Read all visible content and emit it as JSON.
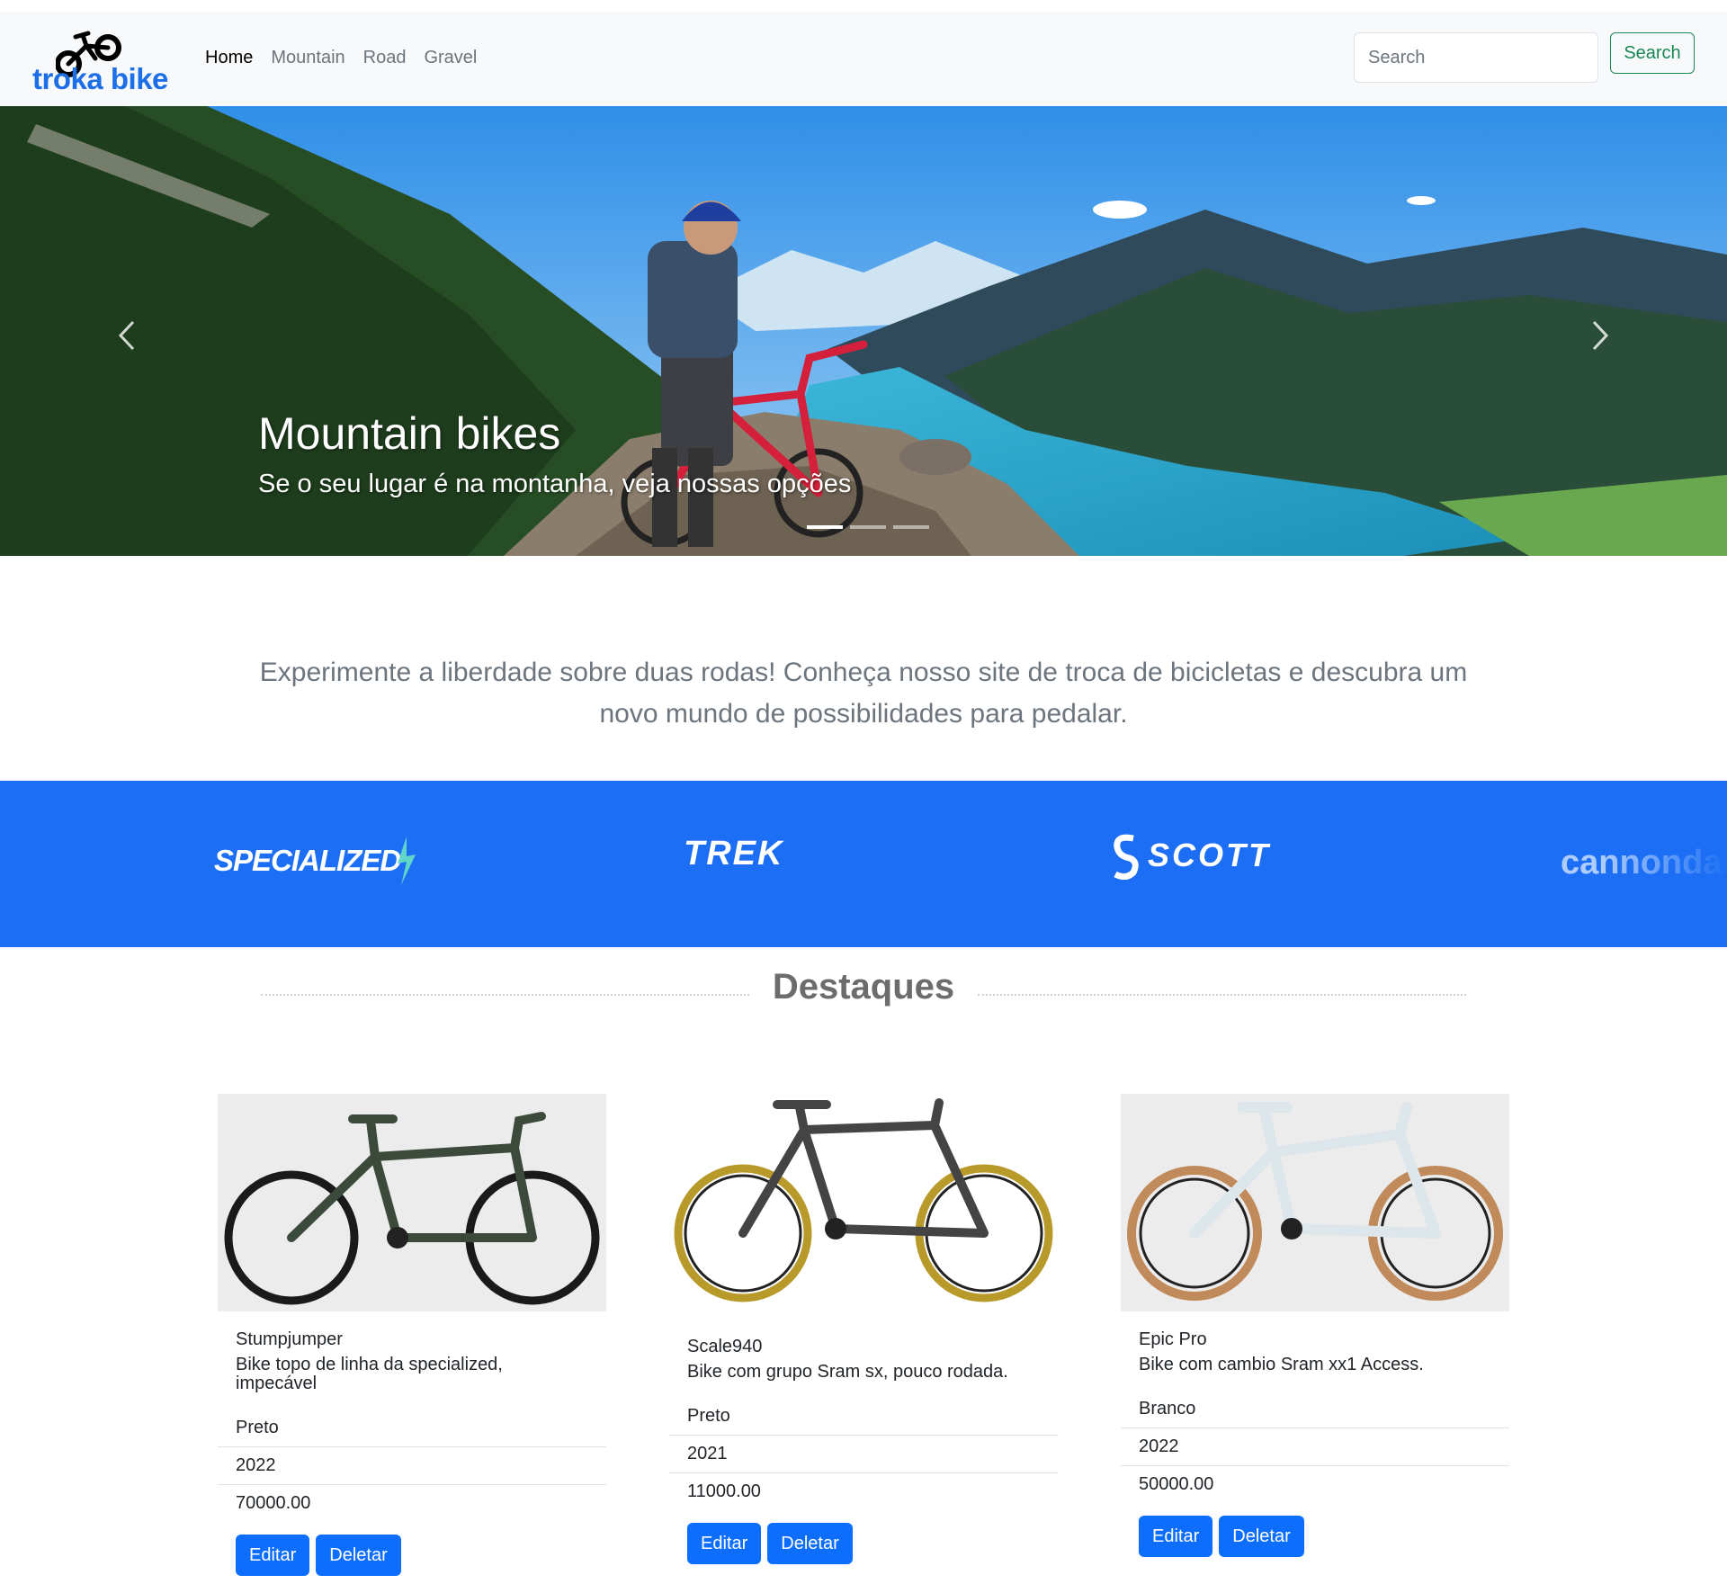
{
  "navbar": {
    "brand": "troka bike",
    "links": [
      {
        "label": "Home",
        "active": true
      },
      {
        "label": "Mountain",
        "active": false
      },
      {
        "label": "Road",
        "active": false
      },
      {
        "label": "Gravel",
        "active": false
      }
    ],
    "search_placeholder": "Search",
    "search_button": "Search"
  },
  "carousel": {
    "title": "Mountain bikes",
    "subtitle": "Se o seu lugar é na montanha, veja nossas opções",
    "slide_count": 3,
    "active_index": 0
  },
  "intro": "Experimente a liberdade sobre duas rodas! Conheça nosso site de troca de bicicletas e descubra um novo mundo de possibilidades para pedalar.",
  "brands": [
    "SPECIALIZED",
    "TREK",
    "SCOTT",
    "cannondale"
  ],
  "section_title": "Destaques",
  "colors": {
    "primary": "#0d6efd",
    "brand_band": "#1c6ff5",
    "success": "#198754",
    "brand_text": "#1d6fe8"
  },
  "products": [
    {
      "name": "Stumpjumper",
      "description": "Bike topo de linha da specialized, impecável",
      "color": "Preto",
      "year": "2022",
      "price": "70000.00",
      "edit": "Editar",
      "delete": "Deletar"
    },
    {
      "name": "Scale940",
      "description": "Bike com grupo Sram sx, pouco rodada.",
      "color": "Preto",
      "year": "2021",
      "price": "11000.00",
      "edit": "Editar",
      "delete": "Deletar"
    },
    {
      "name": "Epic Pro",
      "description": "Bike com cambio Sram xx1 Access.",
      "color": "Branco",
      "year": "2022",
      "price": "50000.00",
      "edit": "Editar",
      "delete": "Deletar"
    }
  ]
}
